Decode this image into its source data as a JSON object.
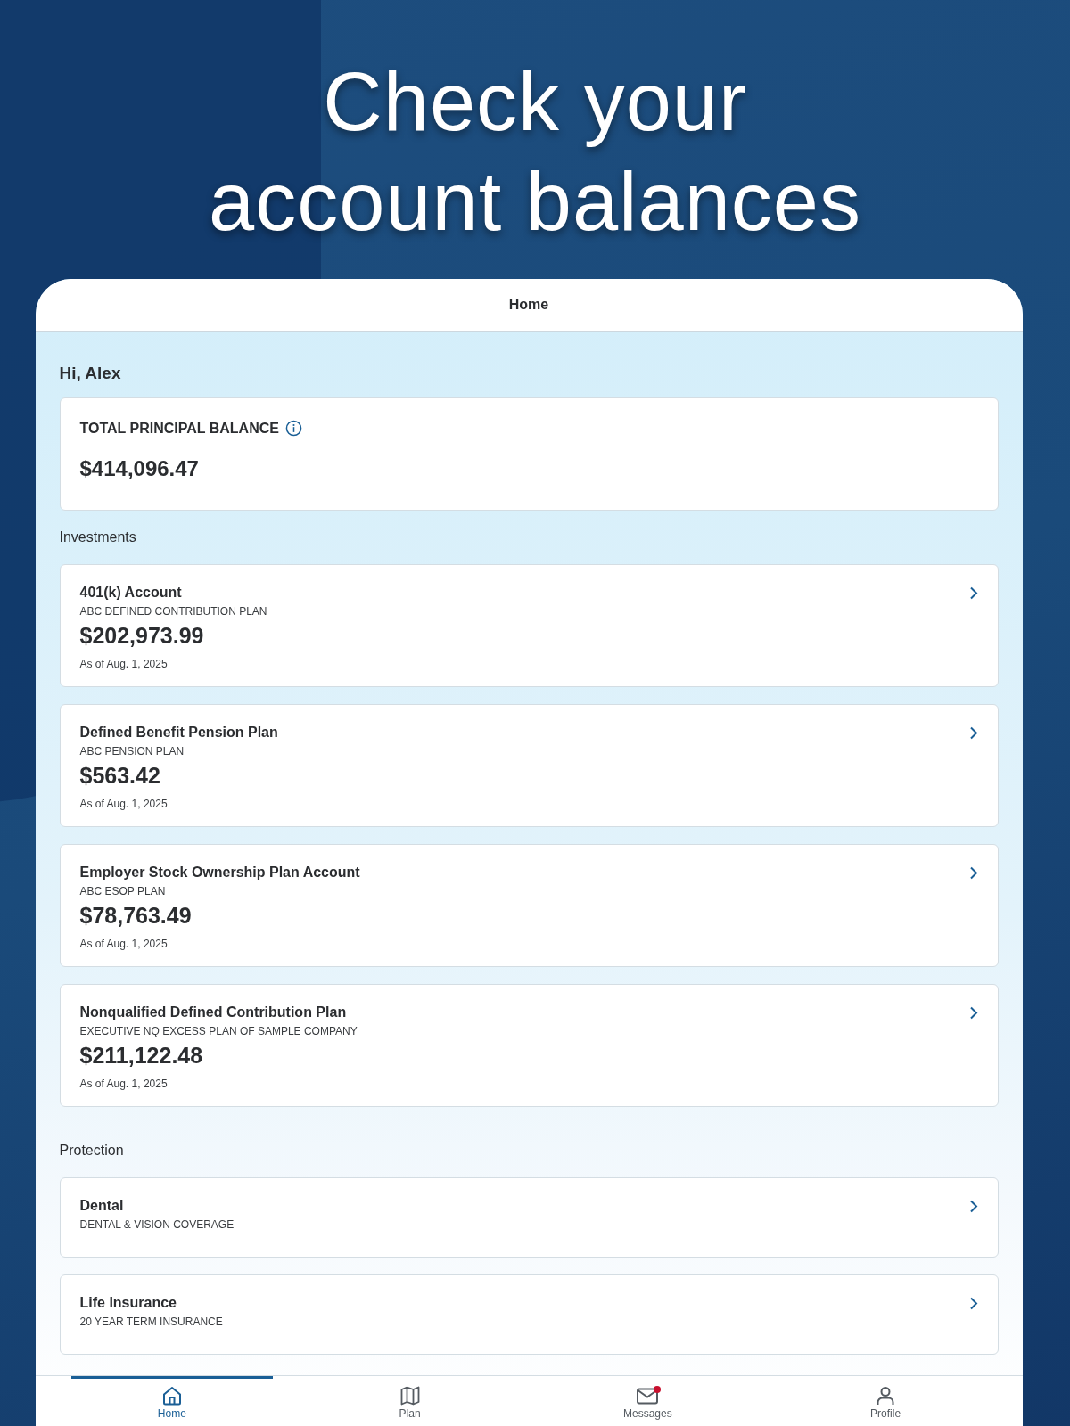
{
  "headline": [
    "Check your",
    "account balances"
  ],
  "screen": {
    "title": "Home",
    "greeting": "Hi, Alex",
    "total": {
      "label": "TOTAL PRINCIPAL BALANCE",
      "amount": "$414,096.47"
    },
    "sections": [
      {
        "title": "Investments",
        "items": [
          {
            "title": "401(k) Account",
            "subtitle": "ABC DEFINED CONTRIBUTION PLAN",
            "amount": "$202,973.99",
            "as_of": "As of Aug. 1, 2025"
          },
          {
            "title": "Defined Benefit Pension Plan",
            "subtitle": "ABC PENSION PLAN",
            "amount": "$563.42",
            "as_of": "As of Aug. 1, 2025"
          },
          {
            "title": "Employer Stock Ownership Plan Account",
            "subtitle": "ABC ESOP PLAN",
            "amount": "$78,763.49",
            "as_of": "As of Aug. 1, 2025"
          },
          {
            "title": "Nonqualified Defined Contribution Plan",
            "subtitle": "EXECUTIVE NQ EXCESS PLAN OF SAMPLE COMPANY",
            "amount": "$211,122.48",
            "as_of": "As of Aug. 1, 2025"
          }
        ]
      },
      {
        "title": "Protection",
        "items": [
          {
            "title": "Dental",
            "subtitle": "DENTAL & VISION COVERAGE"
          },
          {
            "title": "Life Insurance",
            "subtitle": "20 YEAR TERM INSURANCE"
          }
        ]
      }
    ],
    "tabs": [
      {
        "kind": "home",
        "label": "Home",
        "selected": true,
        "unread": false
      },
      {
        "kind": "plan",
        "label": "Plan",
        "selected": false,
        "unread": false
      },
      {
        "kind": "messages",
        "label": "Messages",
        "selected": false,
        "unread": true
      },
      {
        "kind": "profile",
        "label": "Profile",
        "selected": false,
        "unread": false
      }
    ]
  }
}
